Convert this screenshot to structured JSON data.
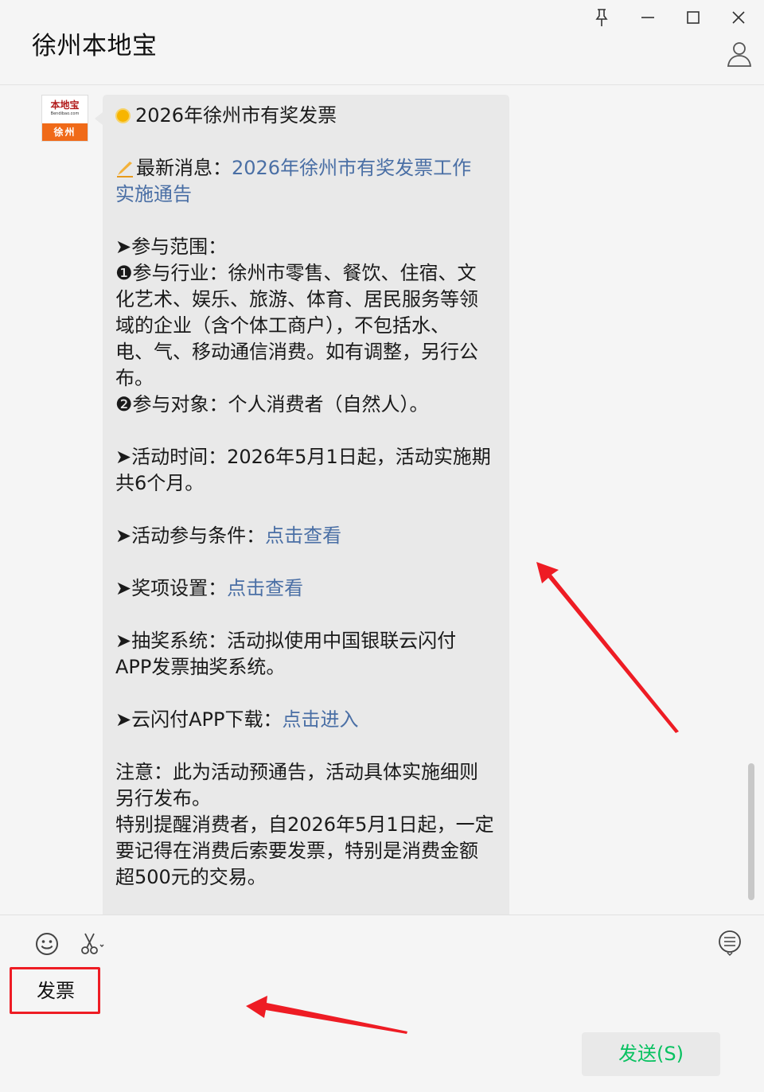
{
  "window": {
    "title": "徐州本地宝",
    "pin_icon": "pin-icon",
    "minimize_icon": "minimize-icon",
    "maximize_icon": "maximize-icon",
    "close_icon": "close-icon",
    "profile_icon": "person-icon"
  },
  "avatar": {
    "logo_text": "本地宝",
    "logo_sub": "Bendibao.com",
    "city": "徐州"
  },
  "message": {
    "title": "2026年徐州市有奖发票",
    "news_label": "最新消息：",
    "news_link_line1": "2026年徐州市有奖发票工作",
    "news_link_line2": "实施通告",
    "scope_heading": "➤参与范围：",
    "scope_lines": [
      "❶参与行业：徐州市零售、餐饮、住宿、文",
      "化艺术、娱乐、旅游、体育、居民服务等领",
      "域的企业（含个体工商户），不包括水、",
      "电、气、移动通信消费。如有调整，另行公",
      "布。",
      "❷参与对象：个人消费者（自然人）。"
    ],
    "time_lines": [
      "➤活动时间：2026年5月1日起，活动实施期",
      "共6个月。"
    ],
    "conditions_label": "➤活动参与条件：",
    "conditions_link": "点击查看",
    "prizes_label": "➤奖项设置：",
    "prizes_link": "点击查看",
    "system_lines": [
      "➤抽奖系统：活动拟使用中国银联云闪付",
      "APP发票抽奖系统。"
    ],
    "download_label": "➤云闪付APP下载：",
    "download_link": "点击进入",
    "note_lines": [
      "注意：此为活动预通告，活动具体实施细则",
      "另行发布。",
      "特别提醒消费者，自2026年5月1日起，一定",
      "要记得在消费后索要发票，特别是消费金额",
      "超500元的交易。"
    ]
  },
  "input": {
    "emoji_icon": "emoji-icon",
    "scissors_icon": "scissors-icon",
    "chat_history_icon": "chat-history-icon",
    "text": "发票",
    "send_label": "发送(S)"
  },
  "colors": {
    "link": "#4a6fa5",
    "send_text": "#07c160",
    "annotation_red": "#ee1c24",
    "brand_orange": "#f06a18"
  }
}
